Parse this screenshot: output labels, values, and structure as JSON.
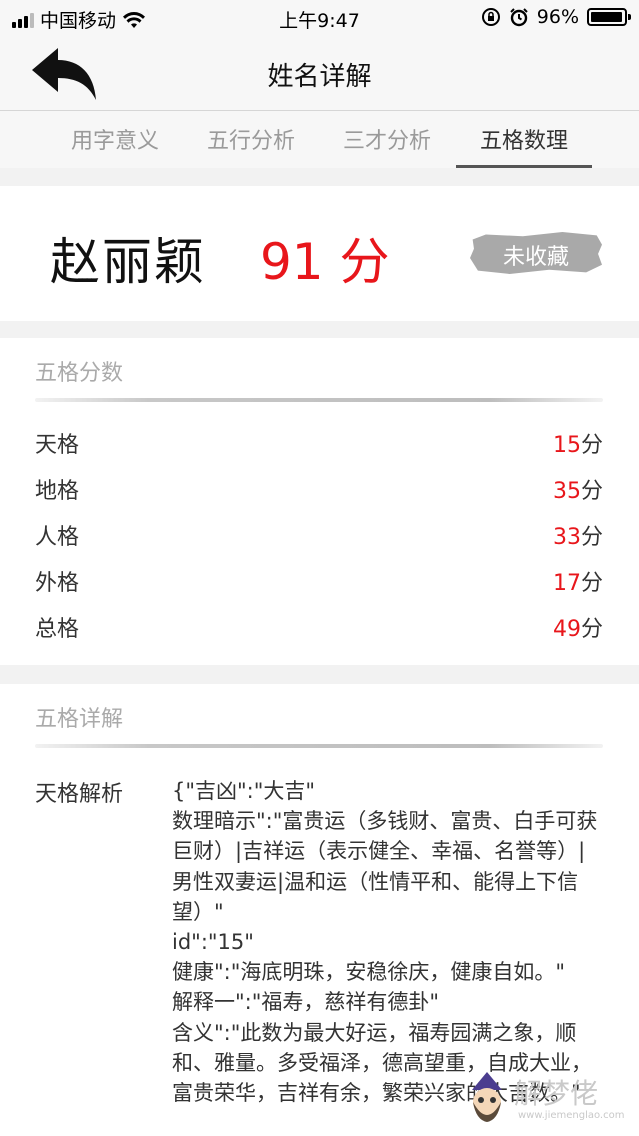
{
  "status_bar": {
    "carrier": "中国移动",
    "time": "上午9:47",
    "battery_text": "96%",
    "battery_level": 0.96
  },
  "nav": {
    "title": "姓名详解"
  },
  "tabs": [
    {
      "label": "用字意义",
      "active": false
    },
    {
      "label": "五行分析",
      "active": false
    },
    {
      "label": "三才分析",
      "active": false
    },
    {
      "label": "五格数理",
      "active": true
    }
  ],
  "summary": {
    "name": "赵丽颖",
    "score": "91 分",
    "collect_label": "未收藏"
  },
  "scores_section": {
    "title": "五格分数",
    "rows": [
      {
        "label": "天格",
        "value": "15",
        "unit": "分"
      },
      {
        "label": "地格",
        "value": "35",
        "unit": "分"
      },
      {
        "label": "人格",
        "value": "33",
        "unit": "分"
      },
      {
        "label": "外格",
        "value": "17",
        "unit": "分"
      },
      {
        "label": "总格",
        "value": "49",
        "unit": "分"
      }
    ]
  },
  "detail_section": {
    "title": "五格详解",
    "item_label": "天格解析",
    "item_text": "{\"吉凶\":\"大吉\"\n数理暗示\":\"富贵运（多钱财、富贵、白手可获巨财）|吉祥运（表示健全、幸福、名誉等）|男性双妻运|温和运（性情平和、能得上下信望）\"\nid\":\"15\"\n健康\":\"海底明珠，安稳徐庆，健康自如。\"\n解释一\":\"福寿，慈祥有德卦\"\n含义\":\"此数为最大好运，福寿园满之象，顺和、雅量。多受福泽，德高望重，自成大业，富贵荣华，吉祥有余，繁荣兴家的大吉数。\""
  },
  "watermark": {
    "text": "解梦佬",
    "url": "www.jiemenglao.com"
  },
  "colors": {
    "accent_red": "#e8161b",
    "tab_active_underline": "#555555"
  }
}
